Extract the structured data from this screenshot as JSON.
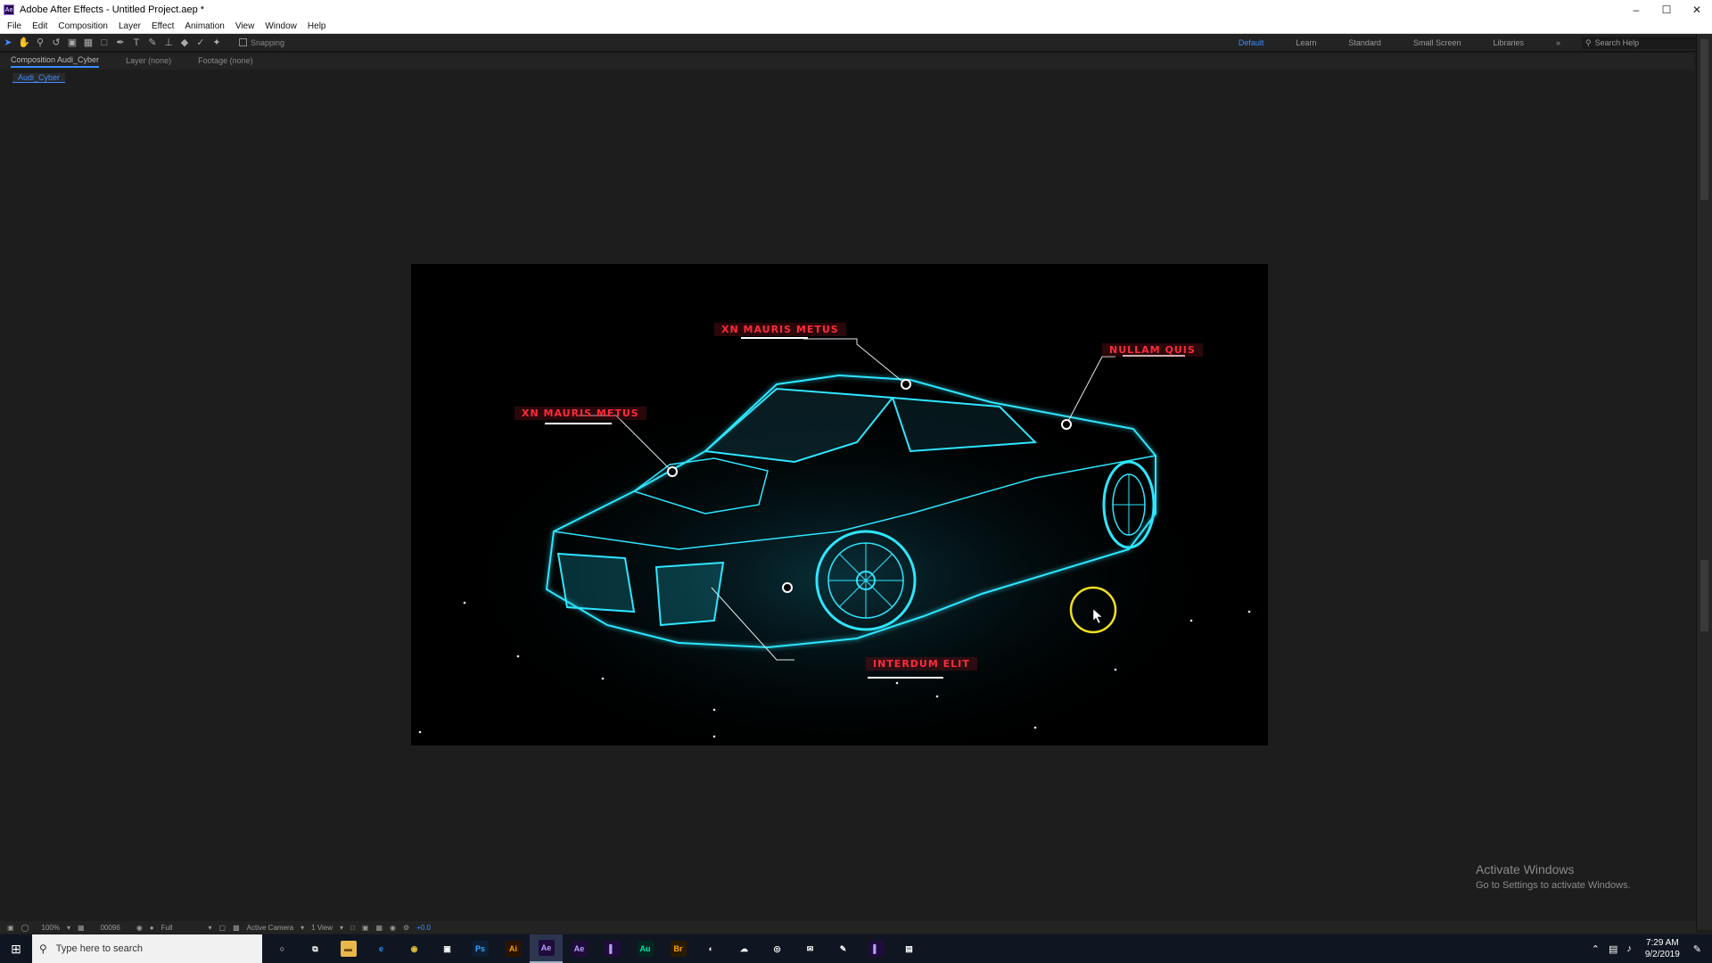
{
  "window": {
    "title": "Adobe After Effects - Untitled Project.aep *",
    "app_icon": "Ae"
  },
  "menu": [
    "File",
    "Edit",
    "Composition",
    "Layer",
    "Effect",
    "Animation",
    "View",
    "Window",
    "Help"
  ],
  "toolbar": {
    "snapping_label": "Snapping",
    "workspaces": [
      "Default",
      "Learn",
      "Standard",
      "Small Screen",
      "Libraries"
    ],
    "active_workspace": "Default",
    "search_placeholder": "Search Help"
  },
  "panels": {
    "composition_tab": "Composition Audi_Cyber",
    "layer_tab": "Layer (none)",
    "footage_tab": "Footage (none)",
    "comp_subtab": "Audi_Cyber"
  },
  "viewer": {
    "callouts": [
      {
        "label": "XN MAURIS METUS"
      },
      {
        "label": "NULLAM QUIS"
      },
      {
        "label": "XN MAURIS METUS"
      },
      {
        "label": "INTERDUM ELIT"
      }
    ]
  },
  "footer": {
    "zoom": "100%",
    "timecode": "00096",
    "resolution": "Full",
    "camera": "Active Camera",
    "views": "1 View",
    "exposure": "+0.0"
  },
  "watermark": {
    "line1": "Activate Windows",
    "line2": "Go to Settings to activate Windows."
  },
  "taskbar": {
    "search_placeholder": "Type here to search",
    "apps": [
      {
        "name": "cortana",
        "glyph": "○",
        "bg": "transparent",
        "fg": "#ffffff"
      },
      {
        "name": "task-view",
        "glyph": "⧉",
        "bg": "transparent",
        "fg": "#ffffff"
      },
      {
        "name": "file-explorer",
        "glyph": "▬",
        "bg": "#e8b84a",
        "fg": "#6b4a10"
      },
      {
        "name": "edge",
        "glyph": "e",
        "bg": "transparent",
        "fg": "#2f8ff0"
      },
      {
        "name": "chrome",
        "glyph": "◉",
        "bg": "transparent",
        "fg": "#e8c33a"
      },
      {
        "name": "store",
        "glyph": "▣",
        "bg": "transparent",
        "fg": "#ffffff"
      },
      {
        "name": "photoshop",
        "glyph": "Ps",
        "bg": "#0d1f35",
        "fg": "#33a7ff"
      },
      {
        "name": "illustrator",
        "glyph": "Ai",
        "bg": "#2a1400",
        "fg": "#ff9a00"
      },
      {
        "name": "after-effects",
        "glyph": "Ae",
        "bg": "#1f0c3a",
        "fg": "#b7a0ff"
      },
      {
        "name": "after-effects-2",
        "glyph": "Ae",
        "bg": "#1f0c3a",
        "fg": "#b7a0ff"
      },
      {
        "name": "premiere",
        "glyph": "▌",
        "bg": "#1f0c3a",
        "fg": "#b7a0ff"
      },
      {
        "name": "audition",
        "glyph": "Au",
        "bg": "#00281f",
        "fg": "#00e4b1"
      },
      {
        "name": "bridge",
        "glyph": "Br",
        "bg": "#2a1a00",
        "fg": "#ffa500"
      },
      {
        "name": "app-round",
        "glyph": "◐",
        "bg": "transparent",
        "fg": "#ffffff"
      },
      {
        "name": "app-cloud",
        "glyph": "☁",
        "bg": "transparent",
        "fg": "#ffffff"
      },
      {
        "name": "app-circle",
        "glyph": "◎",
        "bg": "transparent",
        "fg": "#ffffff"
      },
      {
        "name": "mail",
        "glyph": "✉",
        "bg": "transparent",
        "fg": "#ffffff"
      },
      {
        "name": "app-pen",
        "glyph": "✎",
        "bg": "transparent",
        "fg": "#ffffff"
      },
      {
        "name": "premiere-2",
        "glyph": "▌",
        "bg": "#1f0c3a",
        "fg": "#b7a0ff"
      },
      {
        "name": "app-window",
        "glyph": "▤",
        "bg": "transparent",
        "fg": "#ffffff"
      }
    ],
    "active_app_index": 8,
    "time": "7:29 AM",
    "date": "9/2/2019"
  },
  "colors": {
    "accent": "#3c8cff",
    "callout_red": "#ff2a3a",
    "wireframe_cyan": "#2fe6ff"
  }
}
